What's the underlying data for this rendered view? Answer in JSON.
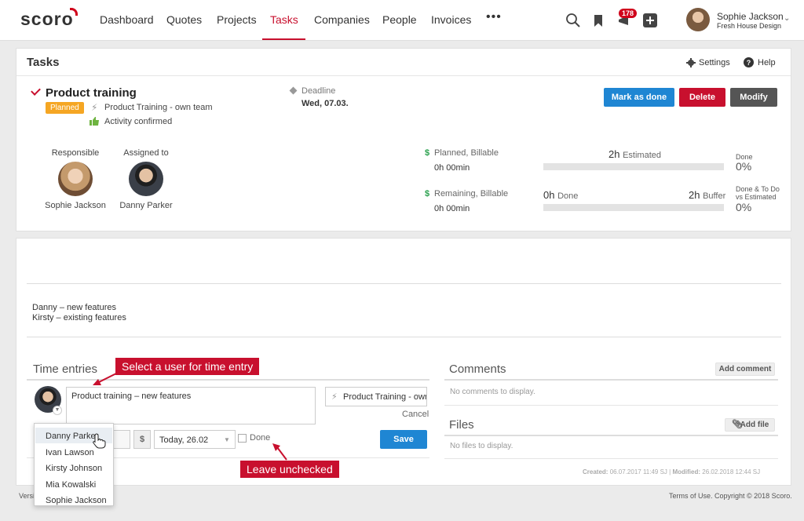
{
  "nav": {
    "logo": "scoro",
    "items": [
      "Dashboard",
      "Quotes",
      "Projects",
      "Tasks",
      "Companies",
      "People",
      "Invoices"
    ],
    "more": "•••",
    "active": "Tasks",
    "notification_count": "178",
    "user_name": "Sophie Jackson",
    "user_company": "Fresh House Design"
  },
  "header": {
    "title": "Tasks",
    "settings": "Settings",
    "help": "Help"
  },
  "task": {
    "name": "Product training",
    "status": "Planned",
    "project": "Product Training - own team",
    "activity": "Activity confirmed",
    "deadline_label": "Deadline",
    "deadline_value": "Wed, 07.03.",
    "mark_done": "Mark as done",
    "delete": "Delete",
    "modify": "Modify",
    "responsible_label": "Responsible",
    "responsible_name": "Sophie Jackson",
    "assigned_label": "Assigned to",
    "assigned_name": "Danny Parker"
  },
  "stats": {
    "planned_label": "Planned, Billable",
    "planned_value": "0h 00min",
    "remaining_label": "Remaining, Billable",
    "remaining_value": "0h 00min",
    "estimated_num": "2h",
    "estimated_lbl": "Estimated",
    "done_num": "0h",
    "done_lbl": "Done",
    "buffer_num": "2h",
    "buffer_lbl": "Buffer",
    "done_label": "Done",
    "done_pct": "0%",
    "done_todo_label_1": "Done & To Do",
    "done_todo_label_2": "vs Estimated",
    "done_todo_pct": "0%",
    "estimated_progress": 0,
    "remaining_progress": 0
  },
  "description": {
    "line1": "Danny – new features",
    "line2": "Kirsty – existing features"
  },
  "time_entries": {
    "title": "Time entries",
    "description_value": "Product training – new features",
    "project_value": "Product Training - own team",
    "cancel": "Cancel",
    "currency": "$",
    "date_value": "Today, 26.02",
    "done_label": "Done",
    "save": "Save",
    "users": [
      "Danny Parker",
      "Ivan Lawson",
      "Kirsty Johnson",
      "Mia Kowalski",
      "Sophie Jackson"
    ]
  },
  "comments": {
    "title": "Comments",
    "add": "Add comment",
    "empty": "No comments to display."
  },
  "files": {
    "title": "Files",
    "add": "Add file",
    "empty": "No files to display."
  },
  "meta": {
    "created_label": "Created:",
    "created_value": "06.07.2017 11:49 SJ",
    "modified_label": "Modified:",
    "modified_value": "26.02.2018 12:44 SJ"
  },
  "callouts": {
    "select_user": "Select a user for time entry",
    "leave_unchecked": "Leave unchecked"
  },
  "footer": {
    "version": "Versi",
    "links": "Terms of Use. Copyright © 2018 Scoro."
  },
  "colors": {
    "brand_red": "#c8102e",
    "primary_blue": "#1f86d3",
    "planned_orange": "#f5a623",
    "money_green": "#2aa14e"
  }
}
